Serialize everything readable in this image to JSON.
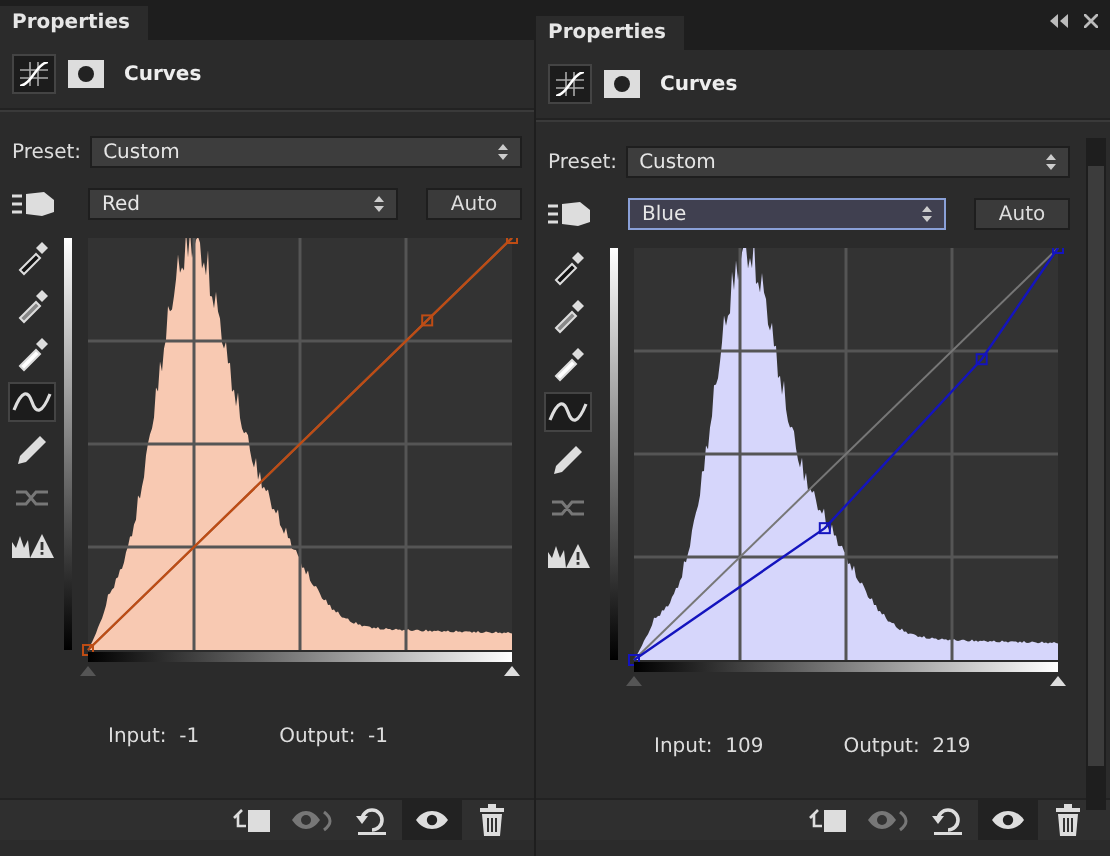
{
  "panels": [
    {
      "tab": "Properties",
      "title": "Curves",
      "preset_label": "Preset:",
      "preset": "Custom",
      "channel": "Red",
      "channel_focused": false,
      "auto": "Auto",
      "color": "#f8c9b2",
      "input_label": "Input:",
      "input": "-1",
      "output_label": "Output:",
      "output": "-1",
      "has_scrollbar": false,
      "tools": [
        {
          "kind": "black-point",
          "selected": false,
          "disabled": false
        },
        {
          "kind": "gray-point",
          "selected": false,
          "disabled": false
        },
        {
          "kind": "white-point",
          "selected": false,
          "disabled": false
        },
        {
          "kind": "curve",
          "selected": true,
          "disabled": false
        },
        {
          "kind": "pencil",
          "selected": false,
          "disabled": false
        },
        {
          "kind": "smooth",
          "selected": false,
          "disabled": true
        },
        {
          "kind": "clipping",
          "selected": false,
          "disabled": false
        }
      ],
      "footer": [
        {
          "kind": "clip",
          "selected": false,
          "disabled": false
        },
        {
          "kind": "view-previous",
          "selected": false,
          "disabled": true
        },
        {
          "kind": "reset",
          "selected": false,
          "disabled": false
        },
        {
          "kind": "visibility",
          "selected": true,
          "disabled": false
        },
        {
          "kind": "delete",
          "selected": false,
          "disabled": false
        }
      ]
    },
    {
      "tab": "Properties",
      "title": "Curves",
      "preset_label": "Preset:",
      "preset": "Custom",
      "channel": "Blue",
      "channel_focused": true,
      "auto": "Auto",
      "color": "#d6d6fb",
      "input_label": "Input:",
      "input": "109",
      "output_label": "Output:",
      "output": "219",
      "has_scrollbar": true,
      "tools": [
        {
          "kind": "black-point",
          "selected": false,
          "disabled": false
        },
        {
          "kind": "gray-point",
          "selected": false,
          "disabled": false
        },
        {
          "kind": "white-point",
          "selected": false,
          "disabled": false
        },
        {
          "kind": "curve",
          "selected": true,
          "disabled": false
        },
        {
          "kind": "pencil",
          "selected": false,
          "disabled": false
        },
        {
          "kind": "smooth",
          "selected": false,
          "disabled": true
        },
        {
          "kind": "clipping",
          "selected": false,
          "disabled": false
        }
      ],
      "footer": [
        {
          "kind": "clip",
          "selected": false,
          "disabled": false
        },
        {
          "kind": "view-previous",
          "selected": false,
          "disabled": true
        },
        {
          "kind": "reset",
          "selected": false,
          "disabled": false
        },
        {
          "kind": "visibility",
          "selected": true,
          "disabled": false
        },
        {
          "kind": "delete",
          "selected": false,
          "disabled": false
        }
      ]
    }
  ]
}
